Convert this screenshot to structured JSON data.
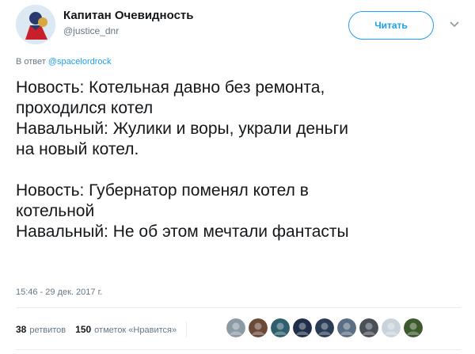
{
  "author": {
    "name": "Капитан Очевидность",
    "handle": "@justice_dnr"
  },
  "follow_button": {
    "label": "Читать"
  },
  "reply_to": {
    "prefix": "В ответ",
    "mention": "@spacelordrock"
  },
  "tweet": {
    "lines": [
      "Новость: Котельная давно без ремонта,",
      "проходился котел",
      "Навальный: Жулики и воры, украли деньги",
      "на новый котел.",
      "",
      "Новость: Губернатор поменял котел в",
      "котельной",
      "Навальный: Не об этом мечтали фантасты"
    ]
  },
  "timestamp": "15:46 - 29 дек. 2017 г.",
  "stats": {
    "retweets_count": "38",
    "retweets_label": "ретвитов",
    "likes_count": "150",
    "likes_label": "отметок «Нравится»"
  },
  "colors": {
    "accent": "#1da1f2",
    "muted": "#657786",
    "text": "#14171a",
    "divider": "#e6ecf0"
  },
  "likers": [
    {
      "name": "liker-avatar-1",
      "color": "#8c9aa6"
    },
    {
      "name": "liker-avatar-2",
      "color": "#6b4a3a"
    },
    {
      "name": "liker-avatar-3",
      "color": "#2f5f6f"
    },
    {
      "name": "liker-avatar-4",
      "color": "#1f2f4a"
    },
    {
      "name": "liker-avatar-5",
      "color": "#2b3c55"
    },
    {
      "name": "liker-avatar-6",
      "color": "#5a6f84"
    },
    {
      "name": "liker-avatar-7",
      "color": "#4a4f58"
    },
    {
      "name": "liker-avatar-8",
      "color": "#c9d3dc"
    },
    {
      "name": "liker-avatar-9",
      "color": "#3c5a2e"
    }
  ]
}
